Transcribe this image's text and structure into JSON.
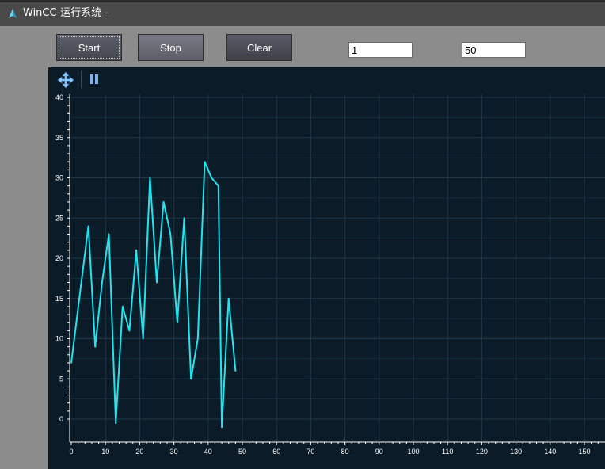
{
  "window": {
    "title": "WinCC-运行系统 -"
  },
  "toolbar": {
    "start_label": "Start",
    "stop_label": "Stop",
    "clear_label": "Clear",
    "range_min_value": "1",
    "range_max_value": "50"
  },
  "chart_toolbar": {
    "icons": [
      "move-icon",
      "pause-icon"
    ]
  },
  "colors": {
    "line": "#1ee6f0",
    "background": "#0b1b27",
    "grid": "#203848",
    "title_bar": "#4a4a4a"
  },
  "chart_data": {
    "type": "line",
    "xlim": [
      0,
      155
    ],
    "ylim": [
      0,
      40
    ],
    "x_ticks": [
      0,
      10,
      20,
      30,
      40,
      50,
      60,
      70,
      80,
      90,
      100,
      110,
      120,
      130,
      140,
      150
    ],
    "y_ticks": [
      0,
      5,
      10,
      15,
      20,
      25,
      30,
      35,
      40
    ],
    "grid": true,
    "series": [
      {
        "x": [
          0,
          5,
          7,
          9,
          11,
          13,
          15,
          17,
          19,
          21,
          23,
          25,
          27,
          29,
          31,
          33,
          35,
          37,
          39,
          41,
          43,
          44,
          46,
          48
        ],
        "y": [
          7,
          24,
          9,
          17,
          23,
          -0.5,
          14,
          11,
          21,
          10,
          30,
          17,
          27,
          23,
          12,
          25,
          5,
          10,
          32,
          30,
          29,
          -1,
          15,
          6
        ]
      }
    ]
  }
}
